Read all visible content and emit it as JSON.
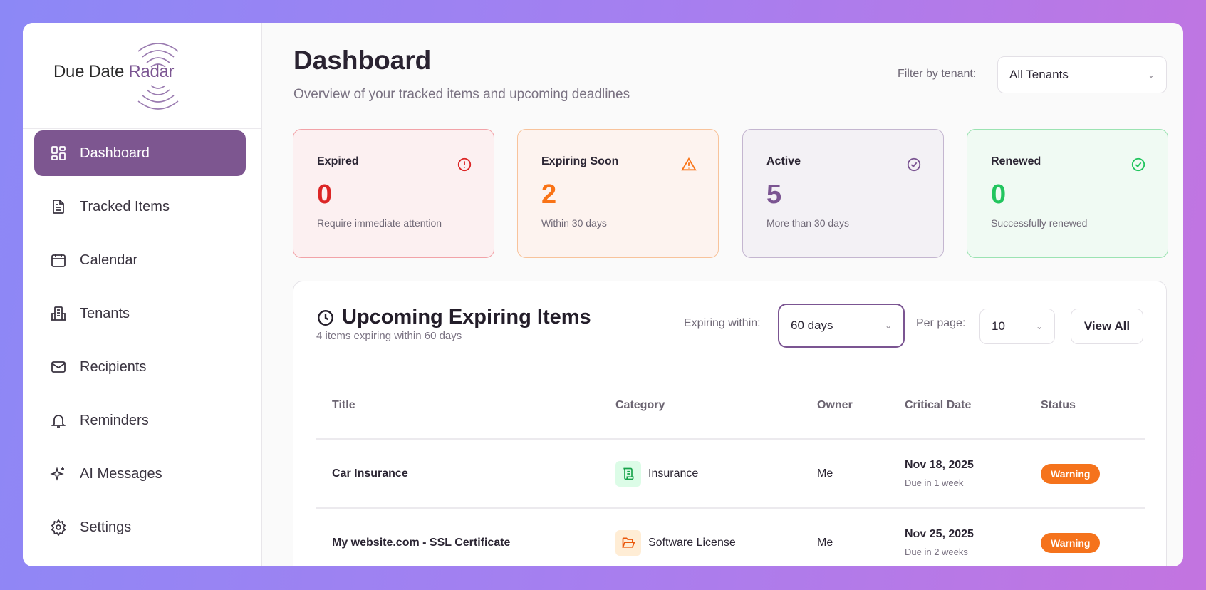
{
  "brand": {
    "name_part1": "Due Date",
    "name_part2": "Radar"
  },
  "sidebar": {
    "items": [
      {
        "label": "Dashboard",
        "icon": "dashboard-grid-icon",
        "active": true
      },
      {
        "label": "Tracked Items",
        "icon": "document-icon"
      },
      {
        "label": "Calendar",
        "icon": "calendar-icon"
      },
      {
        "label": "Tenants",
        "icon": "building-icon"
      },
      {
        "label": "Recipients",
        "icon": "mail-icon"
      },
      {
        "label": "Reminders",
        "icon": "bell-icon"
      },
      {
        "label": "AI Messages",
        "icon": "sparkles-icon"
      },
      {
        "label": "Settings",
        "icon": "gear-icon"
      }
    ]
  },
  "header": {
    "title": "Dashboard",
    "subtitle": "Overview of your tracked items and upcoming deadlines",
    "filter_label": "Filter by tenant:",
    "filter_value": "All Tenants"
  },
  "cards": [
    {
      "title": "Expired",
      "value": "0",
      "sub": "Require immediate attention",
      "icon": "alert-circle-icon",
      "color": "#dc2626"
    },
    {
      "title": "Expiring Soon",
      "value": "2",
      "sub": "Within 30 days",
      "icon": "warning-triangle-icon",
      "color": "#f97316"
    },
    {
      "title": "Active",
      "value": "5",
      "sub": "More than 30 days",
      "icon": "check-circle-icon",
      "color": "#7b5592"
    },
    {
      "title": "Renewed",
      "value": "0",
      "sub": "Successfully renewed",
      "icon": "check-circle-icon",
      "color": "#22c55e"
    }
  ],
  "upcoming": {
    "title": "Upcoming Expiring Items",
    "subtitle": "4 items expiring within 60 days",
    "expiring_label": "Expiring within:",
    "expiring_value": "60 days",
    "per_page_label": "Per page:",
    "per_page_value": "10",
    "view_all": "View All",
    "columns": [
      "Title",
      "Category",
      "Owner",
      "Critical Date",
      "Status"
    ],
    "rows": [
      {
        "title": "Car Insurance",
        "category": "Insurance",
        "owner": "Me",
        "date": "Nov 18, 2025",
        "due": "Due in 1 week",
        "status": "Warning"
      },
      {
        "title": "My website.com - SSL Certificate",
        "category": "Software License",
        "owner": "Me",
        "date": "Nov 25, 2025",
        "due": "Due in 2 weeks",
        "status": "Warning"
      }
    ]
  }
}
